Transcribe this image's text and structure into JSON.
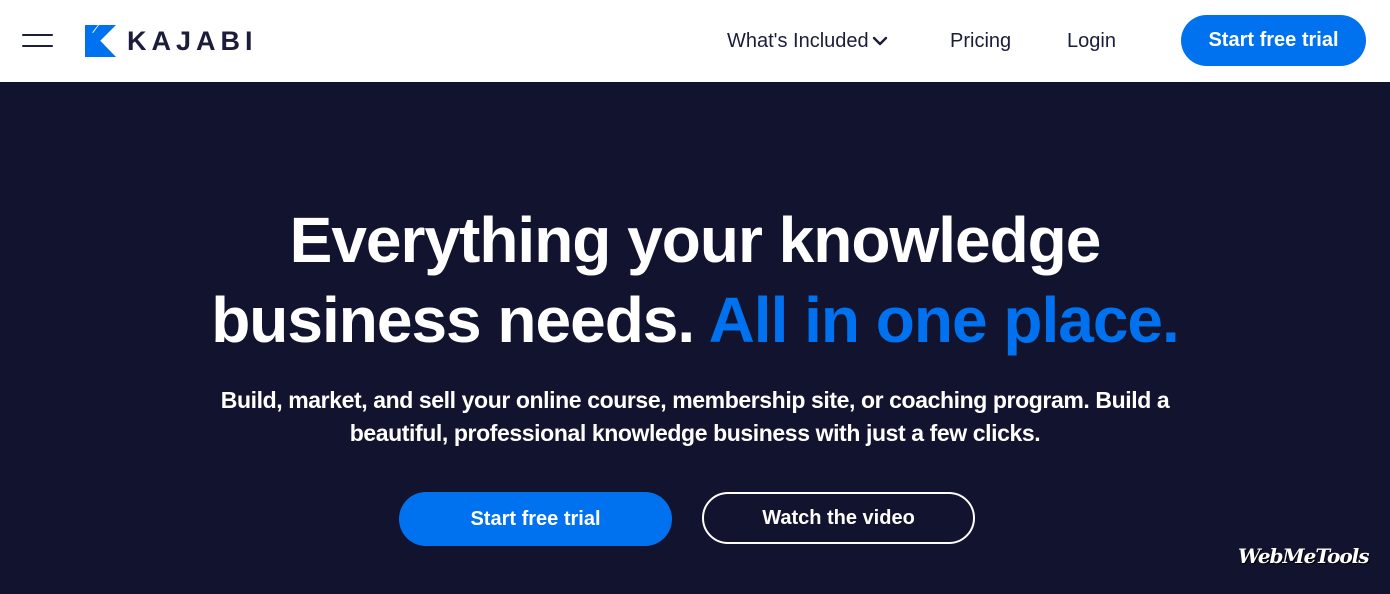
{
  "colors": {
    "accent": "#0072ef",
    "hero_bg": "#12132e",
    "text_dark": "#1b1d3a",
    "white": "#ffffff"
  },
  "header": {
    "menu_icon": "hamburger-menu-icon",
    "logo_icon": "kajabi-k-icon",
    "logo_text": "KAJABI",
    "nav": {
      "included_label": "What's Included",
      "included_icon": "chevron-down-icon",
      "pricing_label": "Pricing",
      "login_label": "Login"
    },
    "cta_label": "Start free trial"
  },
  "hero": {
    "title_line1": "Everything your knowledge",
    "title_line2": "business needs.",
    "title_accent": "All in one place.",
    "subtitle_line1": "Build, market, and sell your online course, membership site, or coaching program. Build a",
    "subtitle_line2": "beautiful, professional knowledge business with just a few clicks.",
    "primary_cta": "Start free trial",
    "secondary_cta": "Watch the video"
  },
  "watermark": "WebMeTools"
}
